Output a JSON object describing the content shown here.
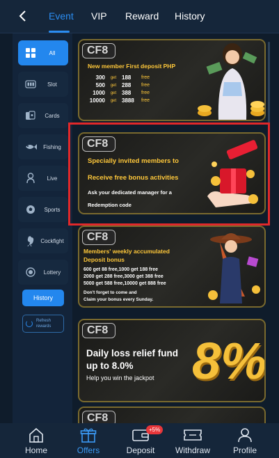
{
  "header": {
    "back_icon": "chevron-left-icon",
    "tabs": [
      {
        "label": "Event",
        "active": true
      },
      {
        "label": "VIP",
        "active": false
      },
      {
        "label": "Reward",
        "active": false
      },
      {
        "label": "History",
        "active": false
      }
    ]
  },
  "sidebar": {
    "items": [
      {
        "label": "All",
        "icon": "grid-icon",
        "active": true
      },
      {
        "label": "Slot",
        "icon": "slot-machine-icon",
        "active": false
      },
      {
        "label": "Cards",
        "icon": "cards-icon",
        "active": false
      },
      {
        "label": "Fishing",
        "icon": "fish-icon",
        "active": false
      },
      {
        "label": "Live",
        "icon": "live-dealer-icon",
        "active": false
      },
      {
        "label": "Sports",
        "icon": "soccer-ball-icon",
        "active": false
      },
      {
        "label": "Cockfight",
        "icon": "rooster-icon",
        "active": false
      },
      {
        "label": "Lottery",
        "icon": "lottery-icon",
        "active": false
      }
    ],
    "history_label": "History",
    "refresh_label_line1": "Refresh",
    "refresh_label_line2": "rewards"
  },
  "cards": [
    {
      "badge": "CF8",
      "title": "New member First deposit PHP",
      "rows": [
        {
          "amount": "300",
          "get": "get",
          "bonus": "188",
          "free": "free"
        },
        {
          "amount": "500",
          "get": "get",
          "bonus": "288",
          "free": "free"
        },
        {
          "amount": "1000",
          "get": "get",
          "bonus": "388",
          "free": "free"
        },
        {
          "amount": "10000",
          "get": "get",
          "bonus": "3888",
          "free": "free"
        }
      ]
    },
    {
      "badge": "CF8",
      "line1": "Specially invited members to",
      "line2": "Receive free bonus activities",
      "line3": "Ask your dedicated manager for a",
      "line4": "Redemption code"
    },
    {
      "badge": "CF8",
      "title1": "Members' weekly accumulated",
      "title2": "Deposit bonus",
      "rows": [
        "600 get 88 free,1000 get 188 free",
        "2000 get 288 free,3000 get 388 free",
        "5000 get 588 free,10000 get 888 free"
      ],
      "note1": "Don't forget to come and",
      "note2": "Claim your bonus every Sunday."
    },
    {
      "badge": "CF8",
      "title1": "Daily loss relief fund",
      "title2": "up to 8.0%",
      "subtitle": "Help you win the jackpot",
      "big_text": "8%"
    },
    {
      "badge": "CF8"
    }
  ],
  "bottom_nav": [
    {
      "label": "Home",
      "icon": "home-icon",
      "active": false
    },
    {
      "label": "Offers",
      "icon": "gift-icon",
      "active": true
    },
    {
      "label": "Deposit",
      "icon": "wallet-icon",
      "active": false
    },
    {
      "label": "Withdraw",
      "icon": "withdraw-ticket-icon",
      "active": false
    },
    {
      "label": "Profile",
      "icon": "person-icon",
      "active": false
    }
  ],
  "deposit_badge": "+5%",
  "colors": {
    "accent": "#2387ee",
    "gold": "#ffc83a",
    "highlight": "#e0282a",
    "background": "#0f1c2b"
  }
}
